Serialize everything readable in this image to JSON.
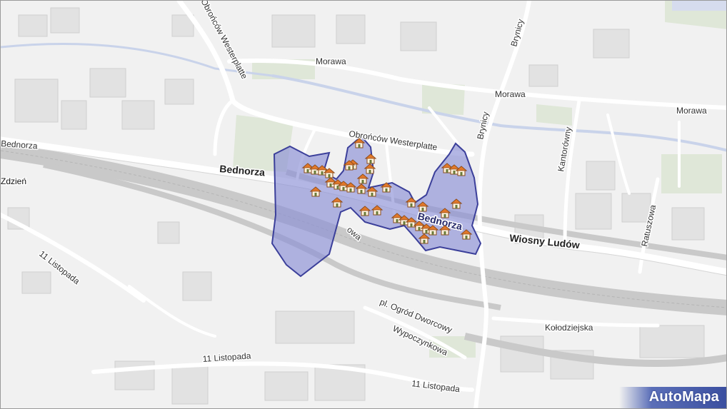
{
  "map": {
    "streets": {
      "obroncow_westerplatte_1": "Obrońców Westerplatte",
      "obroncow_westerplatte_2": "Obrońców Westerplatte",
      "morawa_1": "Morawa",
      "morawa_2": "Morawa",
      "morawa_3": "Morawa",
      "brynicy_1": "Brynicy",
      "brynicy_2": "Brynicy",
      "bednorza_left": "Bednorza",
      "bednorza_main": "Bednorza",
      "bednorza_area": "Bednorza",
      "kantorowny": "Kantorówny",
      "wiosny_ludow": "Wiosny Ludów",
      "ratuszowa": "Ratuszowa",
      "listopada_1": "11 Listopada",
      "listopada_2": "11 Listopada",
      "listopada_3": "11 Listopada",
      "ogrod_dworcowy": "pl. Ogród Dworcowy",
      "wypoczynkowa": "Wypoczynkowa",
      "kolodziejska": "Kołodziejska",
      "zdzien": "Zdzień",
      "owa": "owa"
    },
    "highlight_color": "#8a8fd6",
    "highlight_stroke": "#3b3f9a",
    "marker_icon": "house-icon",
    "marker_count": 42
  },
  "brand": {
    "logo": "AutoMapa"
  }
}
